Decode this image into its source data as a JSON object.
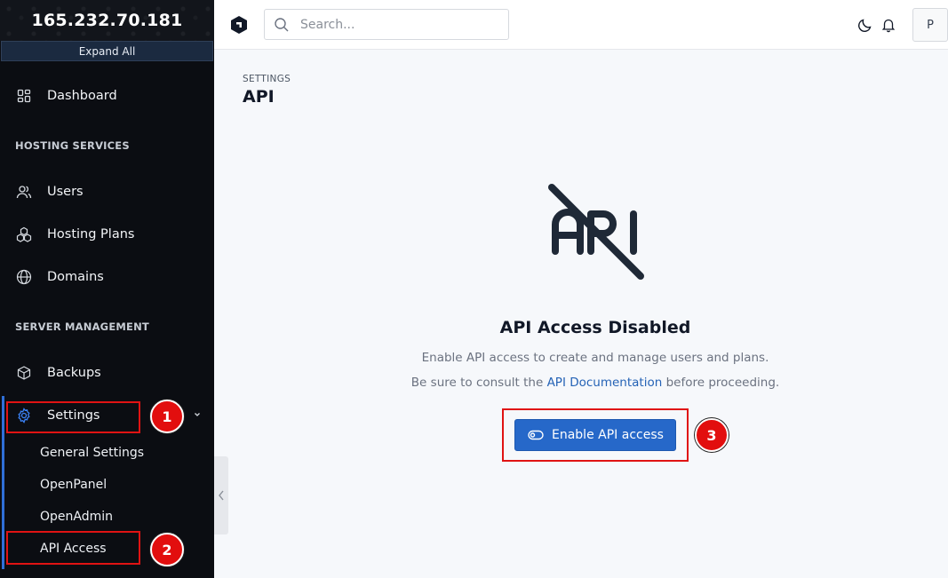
{
  "sidebar": {
    "server_ip": "165.232.70.181",
    "expand_all": "Expand All",
    "dashboard": "Dashboard",
    "section_hosting": "HOSTING SERVICES",
    "users": "Users",
    "hosting_plans": "Hosting Plans",
    "domains": "Domains",
    "section_server": "SERVER MANAGEMENT",
    "backups": "Backups",
    "settings": "Settings",
    "sub_items": [
      "General Settings",
      "OpenPanel",
      "OpenAdmin",
      "API Access"
    ],
    "active_color": "#2f6fd8"
  },
  "topbar": {
    "search_placeholder": "Search...",
    "avatar_letter": "P"
  },
  "main": {
    "breadcrumb": "SETTINGS",
    "title": "API",
    "empty_title": "API Access Disabled",
    "line1": "Enable API access to create and manage users and plans.",
    "line2_prefix": "Be sure to consult the ",
    "line2_link": "API Documentation",
    "line2_suffix": " before proceeding.",
    "enable_button": "Enable API access",
    "button_color": "#2668c9"
  },
  "annotations": {
    "badge1": "1",
    "badge2": "2",
    "badge3": "3",
    "color": "#e01313"
  }
}
